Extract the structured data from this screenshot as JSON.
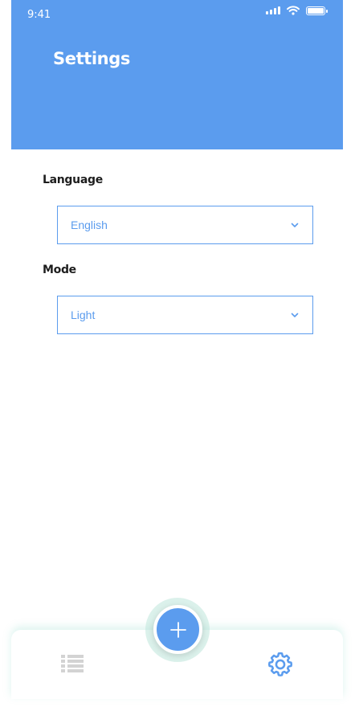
{
  "status_bar": {
    "time": "9:41",
    "icons": [
      "cellular-signal-icon",
      "wifi-icon",
      "battery-icon"
    ],
    "battery_level": 1.0
  },
  "header": {
    "title": "Settings",
    "background_color": "#5b9cee"
  },
  "settings": {
    "language": {
      "label": "Language",
      "selected": "English"
    },
    "mode": {
      "label": "Mode",
      "selected": "Light"
    }
  },
  "bottom_nav": {
    "items": [
      {
        "icon": "list-icon",
        "active": false,
        "color": "#d3d3d3"
      },
      {
        "icon": "gear-icon",
        "active": true,
        "color": "#5b9cee"
      }
    ],
    "fab_icon": "plus-icon"
  },
  "colors": {
    "accent": "#5b9cee",
    "label_text": "#1d1d1d",
    "inactive_icon": "#d3d3d3"
  }
}
